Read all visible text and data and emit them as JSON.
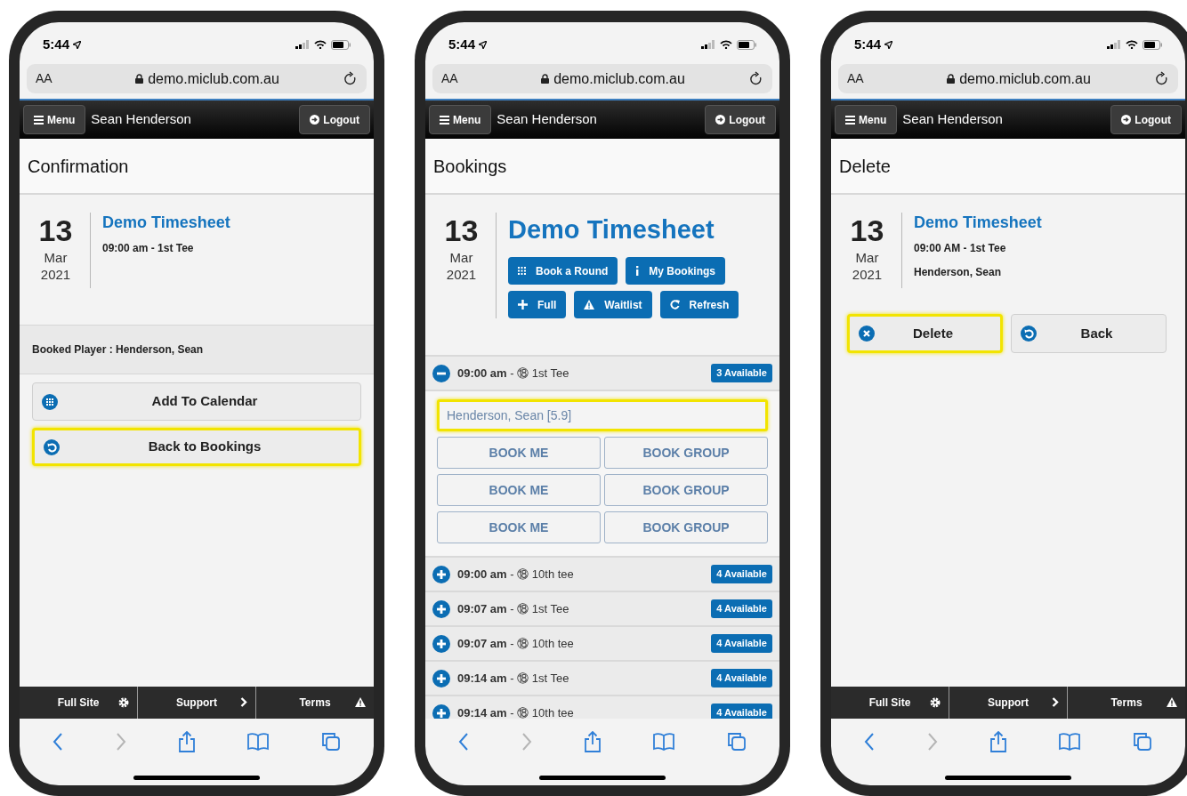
{
  "phones": [
    {
      "kind": "confirmation",
      "status": {
        "time": "5:44"
      },
      "address": {
        "text_size": "AA",
        "url": "demo.miclub.com.au"
      },
      "header": {
        "menu": "Menu",
        "user": "Sean Henderson",
        "logout": "Logout"
      },
      "page_title": "Confirmation",
      "event": {
        "day": "13",
        "month": "Mar",
        "year": "2021",
        "title": "Demo Timesheet",
        "details": [
          "09:00 am - 1st Tee"
        ]
      },
      "booked_player": "Booked Player : Henderson, Sean",
      "actions": [
        {
          "kind": "calendar",
          "label": "Add To Calendar",
          "highlighted": false
        },
        {
          "kind": "back",
          "label": "Back to Bookings",
          "highlighted": true
        }
      ],
      "footer": [
        {
          "kind": "gear",
          "label": "Full Site"
        },
        {
          "kind": "chevron",
          "label": "Support"
        },
        {
          "kind": "warning",
          "label": "Terms"
        }
      ]
    },
    {
      "kind": "bookings",
      "status": {
        "time": "5:44"
      },
      "address": {
        "text_size": "AA",
        "url": "demo.miclub.com.au"
      },
      "header": {
        "menu": "Menu",
        "user": "Sean Henderson",
        "logout": "Logout"
      },
      "page_title": "Bookings",
      "event": {
        "day": "13",
        "month": "Mar",
        "year": "2021",
        "title": "Demo Timesheet"
      },
      "tools": [
        {
          "kind": "grid",
          "label": "Book a Round"
        },
        {
          "kind": "info",
          "label": "My Bookings"
        },
        {
          "kind": "plus",
          "label": "Full"
        },
        {
          "kind": "warning",
          "label": "Waitlist"
        },
        {
          "kind": "refresh",
          "label": "Refresh"
        }
      ],
      "tee_times": [
        {
          "slot": "**09:00 am** - ⑱ 1st Tee",
          "badge": "3 Available",
          "expanded": true,
          "player": {
            "value": "Henderson, Sean [5.9]",
            "highlighted": true
          },
          "slots": [
            {
              "book_me": "BOOK ME",
              "book_group": "BOOK GROUP"
            },
            {
              "book_me": "BOOK ME",
              "book_group": "BOOK GROUP"
            },
            {
              "book_me": "BOOK ME",
              "book_group": "BOOK GROUP"
            }
          ]
        },
        {
          "slot": "**09:00 am** - ⑱ 10th tee",
          "badge": "4 Available",
          "expanded": false
        },
        {
          "slot": "**09:07 am** - ⑱ 1st Tee",
          "badge": "4 Available",
          "expanded": false
        },
        {
          "slot": "**09:07 am** - ⑱ 10th tee",
          "badge": "4 Available",
          "expanded": false
        },
        {
          "slot": "**09:14 am** - ⑱ 1st Tee",
          "badge": "4 Available",
          "expanded": false
        },
        {
          "slot": "**09:14 am** - ⑱ 10th tee",
          "badge": "4 Available",
          "expanded": false
        }
      ]
    },
    {
      "kind": "delete",
      "status": {
        "time": "5:44"
      },
      "address": {
        "text_size": "AA",
        "url": "demo.miclub.com.au"
      },
      "header": {
        "menu": "Menu",
        "user": "Sean Henderson",
        "logout": "Logout"
      },
      "page_title": "Delete",
      "event": {
        "day": "13",
        "month": "Mar",
        "year": "2021",
        "title": "Demo Timesheet",
        "details": [
          "09:00 AM - 1st Tee",
          "Henderson, Sean"
        ]
      },
      "actions": [
        {
          "kind": "delete",
          "label": "Delete",
          "highlighted": true
        },
        {
          "kind": "back",
          "label": "Back",
          "highlighted": false
        }
      ],
      "footer": [
        {
          "kind": "gear",
          "label": "Full Site"
        },
        {
          "kind": "chevron",
          "label": "Support"
        },
        {
          "kind": "warning",
          "label": "Terms"
        }
      ]
    }
  ]
}
